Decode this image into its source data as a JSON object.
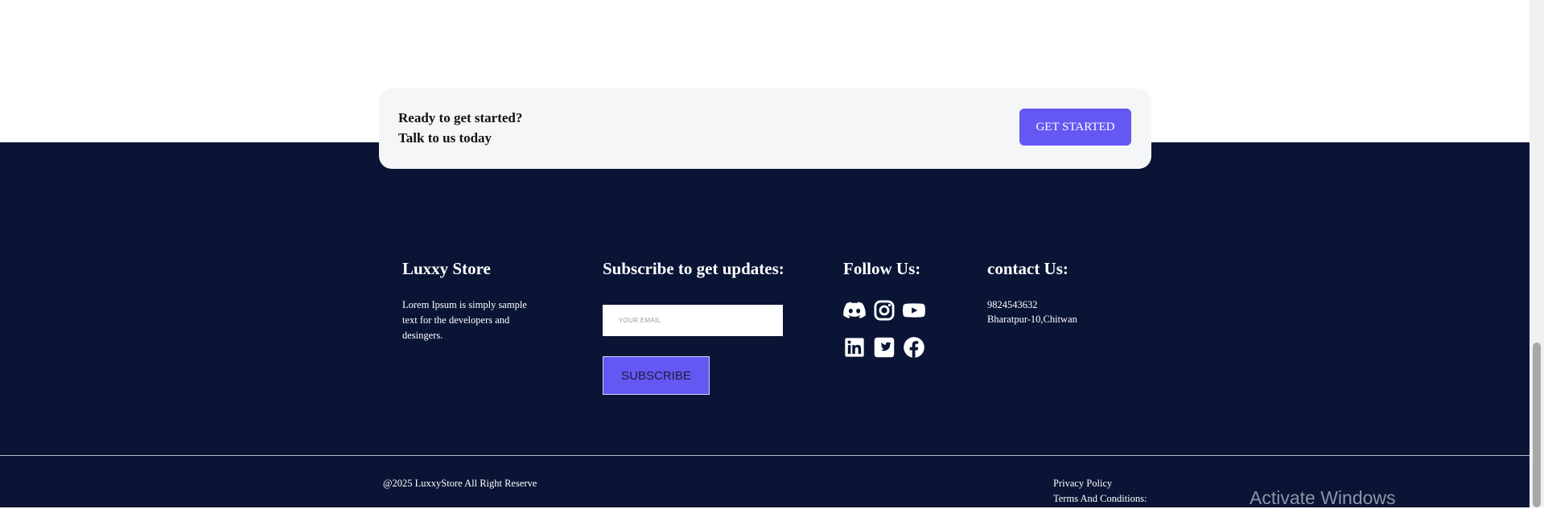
{
  "cta": {
    "line1": "Ready to get started?",
    "line2": "Talk to us today",
    "button_label": "GET STARTED"
  },
  "footer": {
    "brand": {
      "title": "Luxxy Store",
      "description": "Lorem Ipsum is simply sample text for the developers and desingers."
    },
    "subscribe": {
      "title": "Subscribe to get updates:",
      "email_placeholder": "YOUR EMAIL",
      "button_label": "SUBSCRIBE"
    },
    "follow": {
      "title": "Follow Us:",
      "icons": [
        "discord-icon",
        "instagram-icon",
        "youtube-icon",
        "linkedin-icon",
        "twitter-icon",
        "facebook-icon"
      ]
    },
    "contact": {
      "title": "contact Us:",
      "phone": "9824543632",
      "address": "Bharatpur-10,Chitwan"
    },
    "copyright": "@2025 LuxxyStore All Right Reserve",
    "links": {
      "privacy": "Privacy Policy",
      "terms": "Terms And Conditions:"
    }
  },
  "overlay": {
    "watermark": "Activate Windows"
  },
  "colors": {
    "footer_bg": "#0a1435",
    "accent": "#6457f2",
    "cta_bg": "#f5f6f8"
  }
}
